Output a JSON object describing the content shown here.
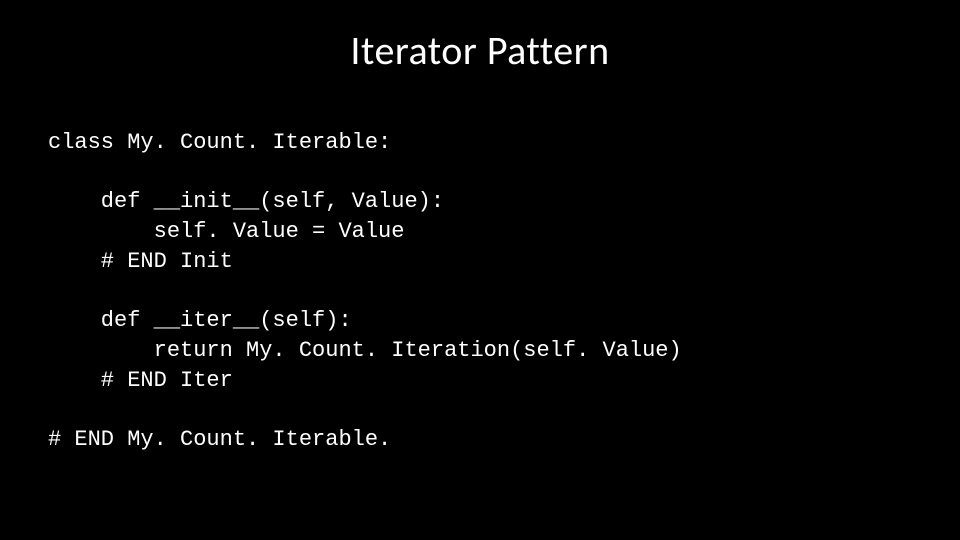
{
  "title": "Iterator Pattern",
  "code": "class My. Count. Iterable:\n\n    def __init__(self, Value):\n        self. Value = Value\n    # END Init\n\n    def __iter__(self):\n        return My. Count. Iteration(self. Value)\n    # END Iter\n\n# END My. Count. Iterable."
}
